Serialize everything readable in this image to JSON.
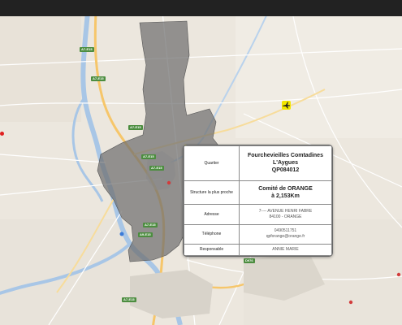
{
  "info_card": {
    "rows": [
      {
        "key": "Quartier",
        "lines": [
          "Fourchevieilles Comtadines L'Aygues",
          "QP084012"
        ]
      },
      {
        "key": "Structure la plus proche",
        "lines": [
          "Comité de ORANGE",
          "à 2,153Km"
        ]
      },
      {
        "key": "Adresse",
        "lines": [
          "7---- AVENUE HENRI FABRE",
          "84100 - ORANGE"
        ]
      },
      {
        "key": "Téléphone",
        "lines": [
          "0490511751",
          "qpforange@orange.fr"
        ]
      },
      {
        "key": "Responsable",
        "lines": [
          "ANNIE MARIE"
        ]
      }
    ]
  },
  "map": {
    "highlight_color": "#6f6f6f",
    "water_color": "#a8c6e6",
    "road_color": "#f6c66a",
    "road_labels": [
      "A7-E15",
      "A7-E15",
      "A7-E15",
      "A7-E15",
      "A7-E15",
      "A7-E15",
      "A9-E15",
      "D976",
      "A7-E15"
    ]
  }
}
